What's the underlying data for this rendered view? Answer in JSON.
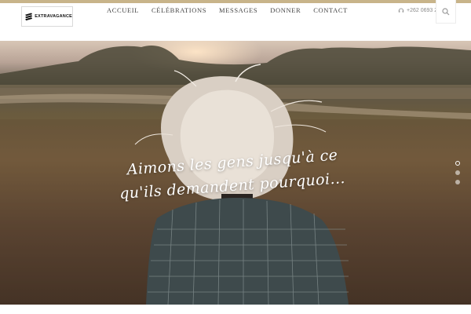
{
  "brand": {
    "name": "EXTRAVAGANCE",
    "logo_icon": "stripes-logo-icon",
    "accent_color": "#c8b48a"
  },
  "nav": {
    "items": [
      {
        "label": "ACCUEIL"
      },
      {
        "label": "CÉLÉBRATIONS"
      },
      {
        "label": "MESSAGES"
      },
      {
        "label": "DONNER"
      },
      {
        "label": "CONTACT"
      }
    ]
  },
  "contact": {
    "phone": "+262 0693 21",
    "phone_icon": "phone-icon"
  },
  "search": {
    "icon": "search-icon"
  },
  "hero": {
    "caption_line1": "Aimons les gens jusqu'à ce",
    "caption_line2": "qu'ils demandent pourquoi...",
    "slides": {
      "count": 3,
      "active": 1
    }
  }
}
